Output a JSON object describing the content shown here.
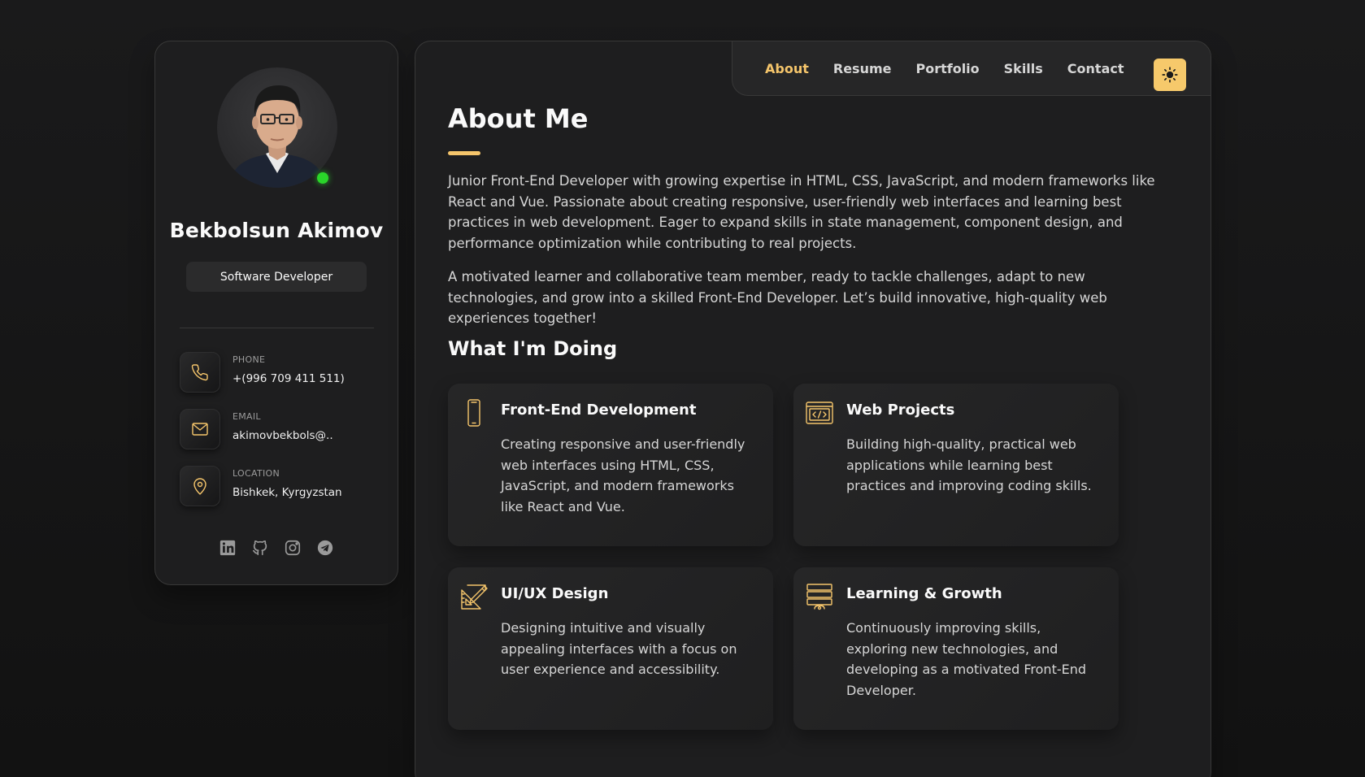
{
  "profile": {
    "name": "Bekbolsun Akimov",
    "role": "Software Developer",
    "status_color": "#2ad52a"
  },
  "contacts": [
    {
      "icon": "phone-icon",
      "label": "PHONE",
      "value": "+(996 709 411 511)"
    },
    {
      "icon": "mail-icon",
      "label": "EMAIL",
      "value": "akimovbekbols@.."
    },
    {
      "icon": "location-pin-icon",
      "label": "LOCATION",
      "value": "Bishkek, Kyrgyzstan"
    }
  ],
  "socials": [
    "linkedin-icon",
    "github-icon",
    "instagram-icon",
    "telegram-icon"
  ],
  "nav": {
    "items": [
      "About",
      "Resume",
      "Portfolio",
      "Skills",
      "Contact"
    ],
    "active": "About",
    "theme_toggle_icon": "sun-icon"
  },
  "about": {
    "title": "About Me",
    "paragraphs": [
      "Junior Front-End Developer with growing expertise in HTML, CSS, JavaScript, and modern frameworks like React and Vue. Passionate about creating responsive, user-friendly web interfaces and learning best practices in web development. Eager to expand skills in state management, component design, and performance optimization while contributing to real projects.",
      "A motivated learner and collaborative team member, ready to tackle challenges, adapt to new technologies, and grow into a skilled Front-End Developer. Let’s build innovative, high-quality web experiences together!"
    ]
  },
  "doing": {
    "title": "What I'm Doing",
    "services": [
      {
        "icon": "mobile-phone-icon",
        "title": "Front-End Development",
        "text": "Creating responsive and user-friendly web interfaces using HTML, CSS, JavaScript, and modern frameworks like React and Vue."
      },
      {
        "icon": "code-window-icon",
        "title": "Web Projects",
        "text": "Building high-quality, practical web applications while learning best practices and improving coding skills."
      },
      {
        "icon": "design-tools-icon",
        "title": "UI/UX Design",
        "text": "Designing intuitive and visually appealing interfaces with a focus on user experience and accessibility."
      },
      {
        "icon": "server-stack-icon",
        "title": "Learning & Growth",
        "text": "Continuously improving skills, exploring new technologies, and developing as a motivated Front-End Developer."
      }
    ]
  },
  "colors": {
    "accent": "#f5c56b",
    "background": "#131313",
    "panel": "#1e1e1f",
    "online": "#2ad52a"
  }
}
